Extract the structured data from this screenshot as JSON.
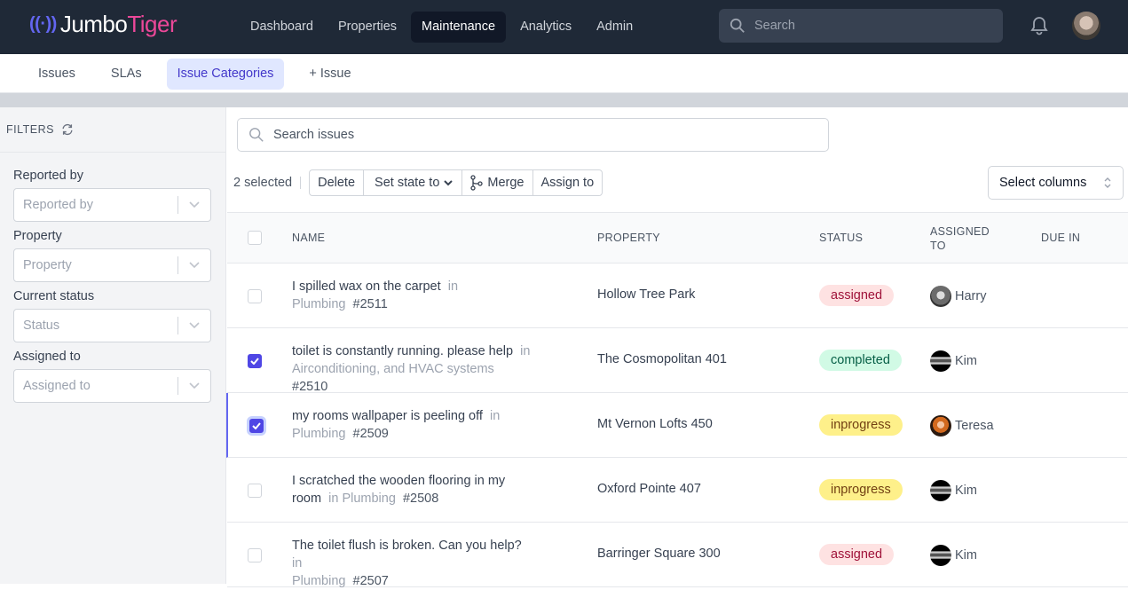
{
  "app": {
    "logo_mark": "((·))",
    "logo_part1": "Jumbo",
    "logo_part2": "Tiger",
    "nav": [
      {
        "label": "Dashboard"
      },
      {
        "label": "Properties"
      },
      {
        "label": "Maintenance",
        "active": true
      },
      {
        "label": "Analytics"
      },
      {
        "label": "Admin"
      }
    ],
    "search_placeholder": "Search",
    "bell_icon": "bell-icon",
    "user_avatar": "user-avatar"
  },
  "subnav": {
    "tabs": [
      {
        "label": "Issues"
      },
      {
        "label": "SLAs"
      },
      {
        "label": "Issue Categories",
        "active": true
      },
      {
        "label": "+ Issue"
      }
    ]
  },
  "filters": {
    "title": "FILTERS",
    "reset_icon": "refresh-icon",
    "fields": [
      {
        "label": "Reported by",
        "placeholder": "Reported by"
      },
      {
        "label": "Property",
        "placeholder": "Property"
      },
      {
        "label": "Current status",
        "placeholder": "Status"
      },
      {
        "label": "Assigned to",
        "placeholder": "Assigned to"
      }
    ]
  },
  "main": {
    "search_placeholder": "Search issues",
    "selected_count": "2 selected",
    "actions": {
      "delete": "Delete",
      "set_state": "Set state to",
      "merge": "Merge",
      "assign": "Assign to"
    },
    "select_columns": "Select columns",
    "columns": {
      "name": "NAME",
      "property": "PROPERTY",
      "status": "STATUS",
      "assigned_line1": "ASSIGNED",
      "assigned_line2": "TO",
      "due": "DUE IN"
    },
    "rows": [
      {
        "title": "I spilled wax on the carpet",
        "in": "in",
        "category": "Plumbing",
        "number": "#2511",
        "property": "Hollow Tree Park",
        "status": "assigned",
        "assignee": "Harry",
        "checked": false
      },
      {
        "title": "toilet is constantly running. please help",
        "in": "in",
        "category": "Airconditioning, and HVAC systems",
        "number": "#2510",
        "property": "The Cosmopolitan 401",
        "status": "completed",
        "assignee": "Kim",
        "checked": true
      },
      {
        "title": "my rooms wallpaper is peeling off",
        "in": "in",
        "category": "Plumbing",
        "number": "#2509",
        "property": "Mt Vernon Lofts 450",
        "status": "inprogress",
        "assignee": "Teresa",
        "checked": true
      },
      {
        "title": "I scratched the wooden flooring in my room",
        "in": "in",
        "category": "Plumbing",
        "number": "#2508",
        "property": "Oxford Pointe 407",
        "status": "inprogress",
        "assignee": "Kim",
        "checked": false
      },
      {
        "title": "The toilet flush is broken. Can you help?",
        "in": "in",
        "category": "Plumbing",
        "number": "#2507",
        "property": "Barringer Square 300",
        "status": "assigned",
        "assignee": "Kim",
        "checked": false
      }
    ]
  }
}
